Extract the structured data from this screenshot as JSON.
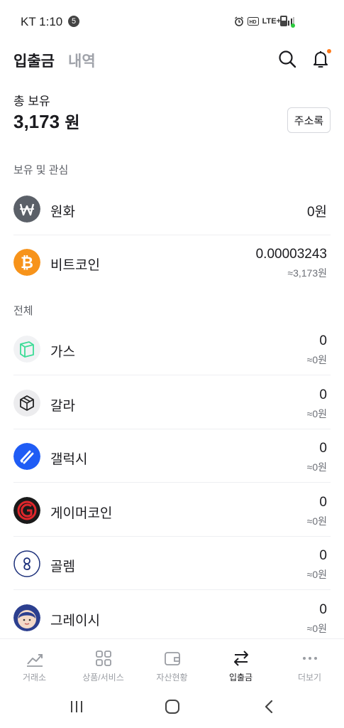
{
  "status_bar": {
    "carrier_time": "KT 1:10",
    "notification_count": "5",
    "network": "LTE+"
  },
  "header": {
    "tabs": [
      {
        "label": "입출금",
        "active": true
      },
      {
        "label": "내역",
        "active": false
      }
    ]
  },
  "total": {
    "label": "총 보유",
    "amount": "3,173",
    "unit": "원",
    "address_book_label": "주소록"
  },
  "sections": {
    "holdings_label": "보유 및 관심",
    "all_label": "전체"
  },
  "holdings": [
    {
      "name": "원화",
      "amount": "0원",
      "sub": "",
      "icon": "won-icon",
      "color": "#5b6068"
    },
    {
      "name": "비트코인",
      "amount": "0.00003243",
      "sub": "≈3,173원",
      "icon": "bitcoin-icon",
      "color": "#f7931a"
    }
  ],
  "all_coins": [
    {
      "name": "가스",
      "amount": "0",
      "sub": "≈0원",
      "icon": "gas-icon",
      "color": "#3ddc97"
    },
    {
      "name": "갈라",
      "amount": "0",
      "sub": "≈0원",
      "icon": "gala-icon",
      "color": "#222222"
    },
    {
      "name": "갤럭시",
      "amount": "0",
      "sub": "≈0원",
      "icon": "galaxy-icon",
      "color": "#1f5cf5"
    },
    {
      "name": "게이머코인",
      "amount": "0",
      "sub": "≈0원",
      "icon": "gamercoin-icon",
      "color": "#e0262b"
    },
    {
      "name": "골렘",
      "amount": "0",
      "sub": "≈0원",
      "icon": "golem-icon",
      "color": "#1b2f7a"
    },
    {
      "name": "그레이시",
      "amount": "0",
      "sub": "≈0원",
      "icon": "gracy-icon",
      "color": "#2c3f8f"
    }
  ],
  "bottom_nav": [
    {
      "label": "거래소",
      "icon": "chart-line-icon",
      "active": false
    },
    {
      "label": "상품/서비스",
      "icon": "grid-icon",
      "active": false
    },
    {
      "label": "자산현황",
      "icon": "wallet-icon",
      "active": false
    },
    {
      "label": "입출금",
      "icon": "transfer-arrows-icon",
      "active": true
    },
    {
      "label": "더보기",
      "icon": "more-dots-icon",
      "active": false
    }
  ],
  "system_nav": {
    "buttons": [
      "recent-apps-icon",
      "home-icon",
      "back-icon"
    ]
  }
}
